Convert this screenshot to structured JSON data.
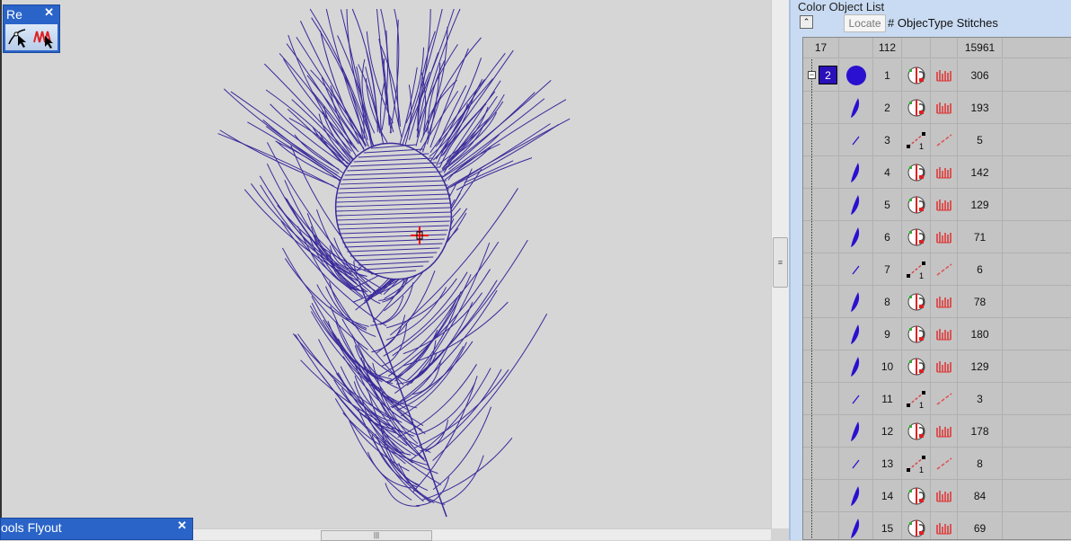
{
  "flyouts": {
    "reshape": {
      "title": "Re",
      "close": "✕"
    },
    "tools": {
      "title": "ools Flyout",
      "close": "✕"
    }
  },
  "panel": {
    "title": "Color  Object List",
    "locate_label": "Locate",
    "columns_label": "#  ObjecType Stitches",
    "summary": {
      "colors": "17",
      "objects": "112",
      "stitches": "15961"
    },
    "color_group": {
      "number": "2",
      "color": "#2a10b8"
    },
    "rows": [
      {
        "num": "1",
        "type": "fill",
        "stitches": "306",
        "shape": "circle"
      },
      {
        "num": "2",
        "type": "fill",
        "stitches": "193"
      },
      {
        "num": "3",
        "type": "run",
        "stitches": "5"
      },
      {
        "num": "4",
        "type": "fill",
        "stitches": "142"
      },
      {
        "num": "5",
        "type": "fill",
        "stitches": "129"
      },
      {
        "num": "6",
        "type": "fill",
        "stitches": "71"
      },
      {
        "num": "7",
        "type": "run",
        "stitches": "6"
      },
      {
        "num": "8",
        "type": "fill",
        "stitches": "78"
      },
      {
        "num": "9",
        "type": "fill",
        "stitches": "180"
      },
      {
        "num": "10",
        "type": "fill",
        "stitches": "129"
      },
      {
        "num": "11",
        "type": "run",
        "stitches": "3"
      },
      {
        "num": "12",
        "type": "fill",
        "stitches": "178"
      },
      {
        "num": "13",
        "type": "run",
        "stitches": "8"
      },
      {
        "num": "14",
        "type": "fill",
        "stitches": "84"
      },
      {
        "num": "15",
        "type": "fill",
        "stitches": "69"
      }
    ]
  },
  "design_color": "#3a2a9a"
}
